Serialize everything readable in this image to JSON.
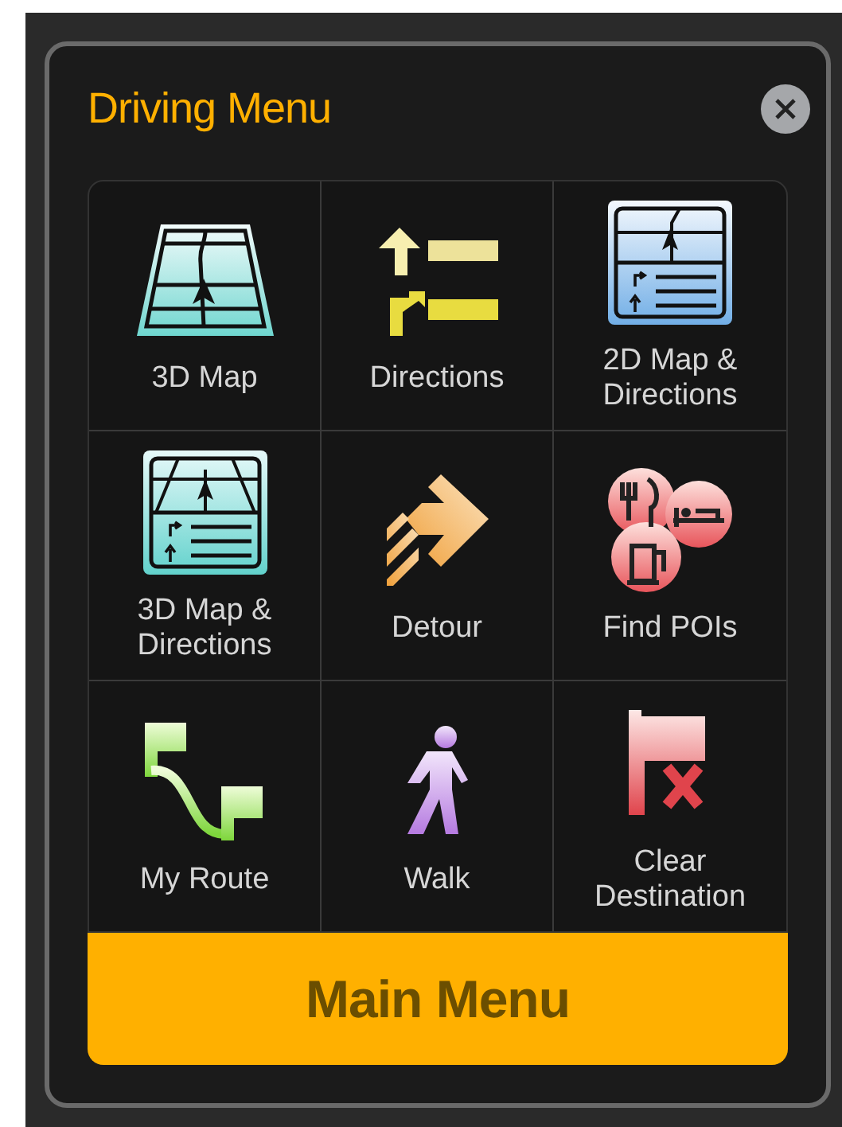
{
  "dialog": {
    "title": "Driving Menu"
  },
  "items": [
    {
      "kind": "map3d",
      "label": "3D Map"
    },
    {
      "kind": "directions",
      "label": "Directions"
    },
    {
      "kind": "map2d_directions",
      "label": "2D Map & Directions"
    },
    {
      "kind": "map3d_directions",
      "label": "3D Map & Directions"
    },
    {
      "kind": "detour",
      "label": "Detour"
    },
    {
      "kind": "pois",
      "label": "Find POIs"
    },
    {
      "kind": "route",
      "label": "My Route"
    },
    {
      "kind": "walk",
      "label": "Walk"
    },
    {
      "kind": "clear",
      "label": "Clear Destination"
    }
  ],
  "main_button": {
    "label": "Main Menu"
  }
}
